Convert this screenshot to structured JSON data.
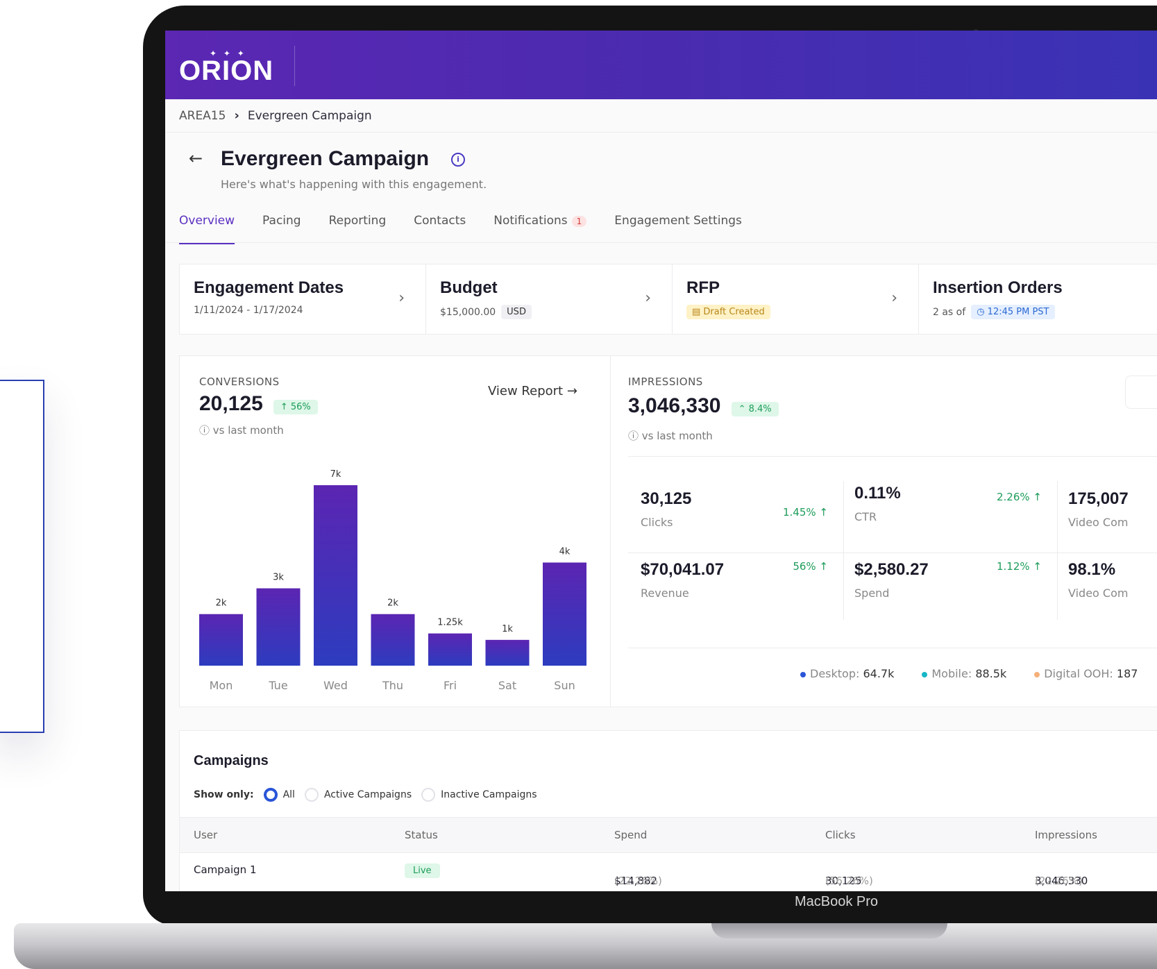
{
  "app": {
    "logo": "ORION"
  },
  "device": {
    "label": "MacBook Pro"
  },
  "breadcrumb": {
    "root": "AREA15",
    "current": "Evergreen Campaign"
  },
  "header": {
    "title": "Evergreen Campaign",
    "subtitle": "Here's what's happening with this engagement."
  },
  "tabs": [
    {
      "label": "Overview",
      "active": true
    },
    {
      "label": "Pacing"
    },
    {
      "label": "Reporting"
    },
    {
      "label": "Contacts"
    },
    {
      "label": "Notifications",
      "badge": "1"
    },
    {
      "label": "Engagement Settings"
    }
  ],
  "summary": {
    "dates": {
      "title": "Engagement Dates",
      "value": "1/11/2024 - 1/17/2024"
    },
    "budget": {
      "title": "Budget",
      "value": "$15,000.00",
      "currency": "USD"
    },
    "rfp": {
      "title": "RFP",
      "status": "Draft Created"
    },
    "orders": {
      "title": "Insertion Orders",
      "value": "2 as of",
      "time": "12:45 PM PST"
    }
  },
  "conversions": {
    "caption": "CONVERSIONS",
    "value": "20,125",
    "delta": "↑ 56%",
    "vs": "vs last month",
    "view_report": "View Report"
  },
  "chart_data": {
    "type": "bar",
    "categories": [
      "Mon",
      "Tue",
      "Wed",
      "Thu",
      "Fri",
      "Sat",
      "Sun"
    ],
    "values": [
      2000,
      3000,
      7000,
      2000,
      1250,
      1000,
      4000
    ],
    "data_labels": [
      "2k",
      "3k",
      "7k",
      "2k",
      "1.25k",
      "1k",
      "4k"
    ],
    "grid": false,
    "colors": {
      "bar_top": "#5b25b2",
      "bar_bottom": "#2d3cbf"
    }
  },
  "impressions": {
    "caption": "IMPRESSIONS",
    "value": "3,046,330",
    "delta": "⌃ 8.4%",
    "vs": "vs last month"
  },
  "metrics": [
    {
      "value": "30,125",
      "label": "Clicks",
      "delta": "1.45% ↑"
    },
    {
      "value": "0.11%",
      "label": "CTR",
      "delta": "2.26% ↑"
    },
    {
      "value": "175,007",
      "label": "Video Com"
    },
    {
      "value": "$70,041.07",
      "label": "Revenue",
      "delta": "56% ↑"
    },
    {
      "value": "$2,580.27",
      "label": "Spend",
      "delta": "1.12% ↑"
    },
    {
      "value": "98.1%",
      "label": "Video Com"
    }
  ],
  "legend": [
    {
      "label": "Desktop:",
      "value": "64.7k",
      "color": "#2a55d8"
    },
    {
      "label": "Mobile:",
      "value": "88.5k",
      "color": "#18b6c6"
    },
    {
      "label": "Digital OOH:",
      "value": "187",
      "color": "#f4b07a"
    }
  ],
  "campaigns": {
    "title": "Campaigns",
    "filter_label": "Show only:",
    "filters": [
      "All",
      "Active Campaigns",
      "Inactive Campaigns"
    ],
    "columns": [
      "User",
      "Status",
      "Spend",
      "Clicks",
      "Impressions"
    ],
    "rows": [
      {
        "user": "Campaign 1",
        "status": "Live",
        "spend": "$14,882",
        "spend_pct": "(22.26%)",
        "clicks": "30,125",
        "clicks_pct": "(56.26%)",
        "impressions": "3,046,330",
        "impressions_pct": "(22.26%)"
      }
    ]
  }
}
